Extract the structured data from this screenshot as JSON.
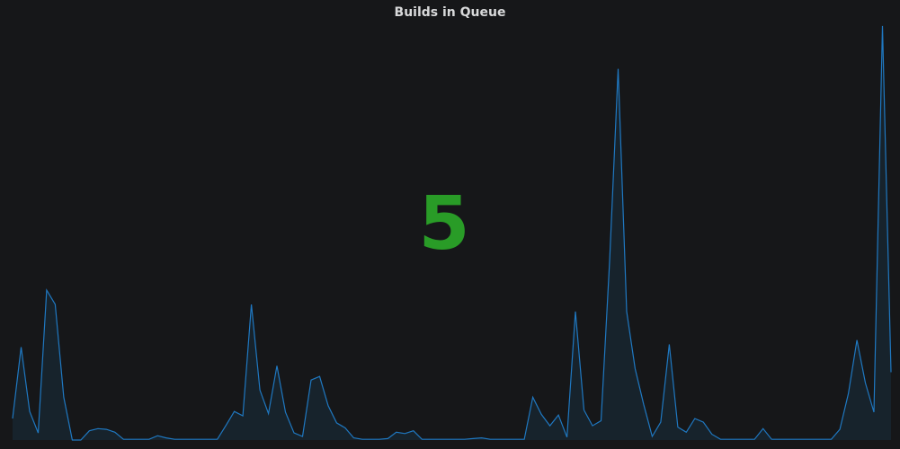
{
  "panel": {
    "title": "Builds in Queue",
    "value": "5"
  },
  "colors": {
    "background": "#161719",
    "title": "#d8d9da",
    "value": "#299c27",
    "line": "#1f78c1",
    "fill": "#1f78c1"
  },
  "chart_data": {
    "type": "area",
    "series": [
      {
        "values": [
          3,
          13,
          4,
          1,
          21,
          19,
          6,
          0,
          0,
          1.3,
          1.6,
          1.5,
          1.1,
          0.1,
          0.1,
          0.1,
          0.1,
          0.6,
          0.3,
          0.1,
          0.1,
          0.1,
          0.1,
          0.1,
          0.1,
          2,
          4,
          3.4,
          19,
          7,
          3.7,
          10.4,
          3.9,
          1,
          0.5,
          8.4,
          8.9,
          4.8,
          2.4,
          1.7,
          0.3,
          0.1,
          0.1,
          0.1,
          0.2,
          1.1,
          0.9,
          1.3,
          0.1,
          0.1,
          0.1,
          0.1,
          0.1,
          0.1,
          0.2,
          0.3,
          0.1,
          0.1,
          0.1,
          0.1,
          0.1,
          6,
          3.6,
          2,
          3.5,
          0.4,
          18,
          4.2,
          2,
          2.7,
          25,
          52,
          18,
          10,
          5,
          0.5,
          2.5,
          13.4,
          1.8,
          1.1,
          3,
          2.5,
          0.8,
          0.1,
          0.1,
          0.1,
          0.1,
          0.1,
          1.6,
          0.1,
          0.1,
          0.1,
          0.1,
          0.1,
          0.1,
          0.1,
          0.1,
          1.5,
          6.5,
          14,
          8,
          3.9,
          58,
          9.5
        ]
      }
    ],
    "ylim": [
      0,
      60
    ]
  }
}
